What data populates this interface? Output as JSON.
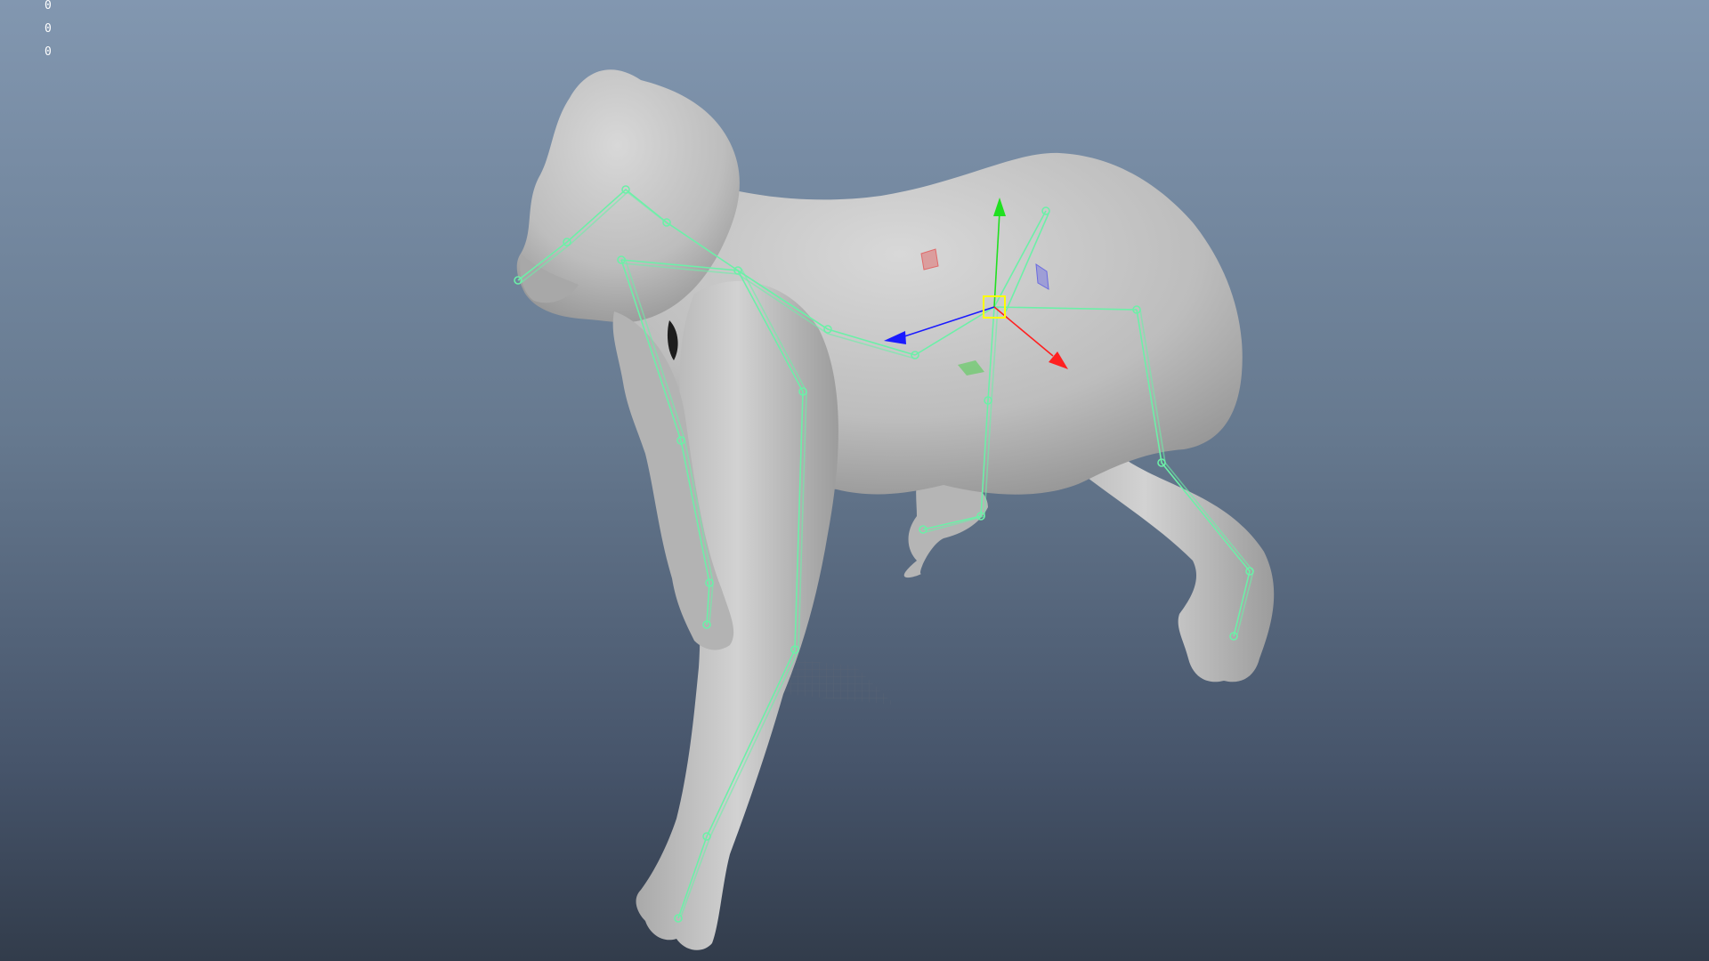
{
  "viewport": {
    "hud_values": [
      "0",
      "0",
      "0"
    ]
  },
  "colors": {
    "joint": "#6cf0a8",
    "gizmo_x": "#ff2020",
    "gizmo_y": "#20e020",
    "gizmo_z": "#1a1aff",
    "pivot": "#ffff00",
    "mesh": "#c9c9c9"
  },
  "icons": {
    "move_manipulator": "move-tool-gizmo",
    "selected_pivot": "pivot-handle"
  }
}
